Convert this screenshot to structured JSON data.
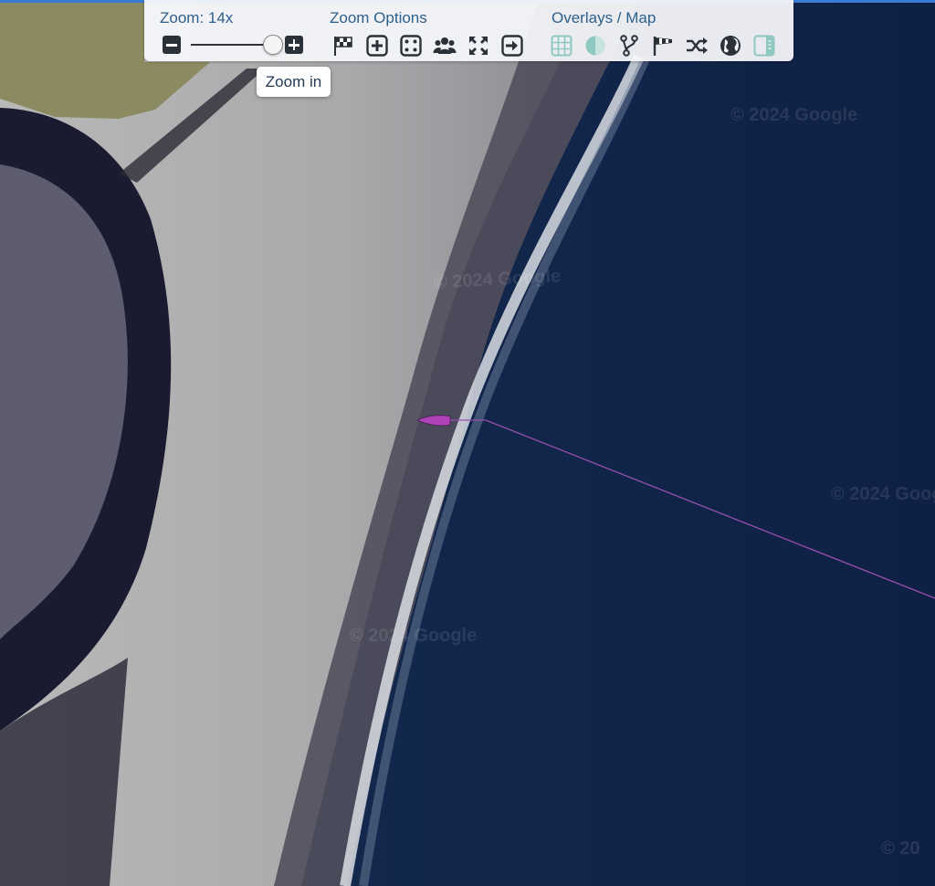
{
  "toolbar": {
    "zoom_title": "Zoom: 14x",
    "zoom_options_title": "Zoom Options",
    "overlays_title": "Overlays / Map",
    "zoom_level": 14,
    "slider_fraction": 0.97
  },
  "tooltip": {
    "text": "Zoom in"
  },
  "zoom_option_icons": [
    "flag-icon",
    "zoom-plus-icon",
    "dice-icon",
    "group-icon",
    "expand-icon",
    "sign-in-icon"
  ],
  "overlay_icons": [
    "grid-icon",
    "contrast-icon",
    "branch-icon",
    "windsock-icon",
    "shuffle-icon",
    "globe-icon",
    "panel-icon"
  ],
  "watermarks": [
    "© 2024 Google",
    "© 2024 Google",
    "© 2024 Google",
    "© 2024 Google",
    "© 20"
  ],
  "colors": {
    "ocean": "#13254a",
    "track": "#9a4fb0",
    "boat": "#b043b8",
    "toolbar_text": "#2e5f8a"
  }
}
